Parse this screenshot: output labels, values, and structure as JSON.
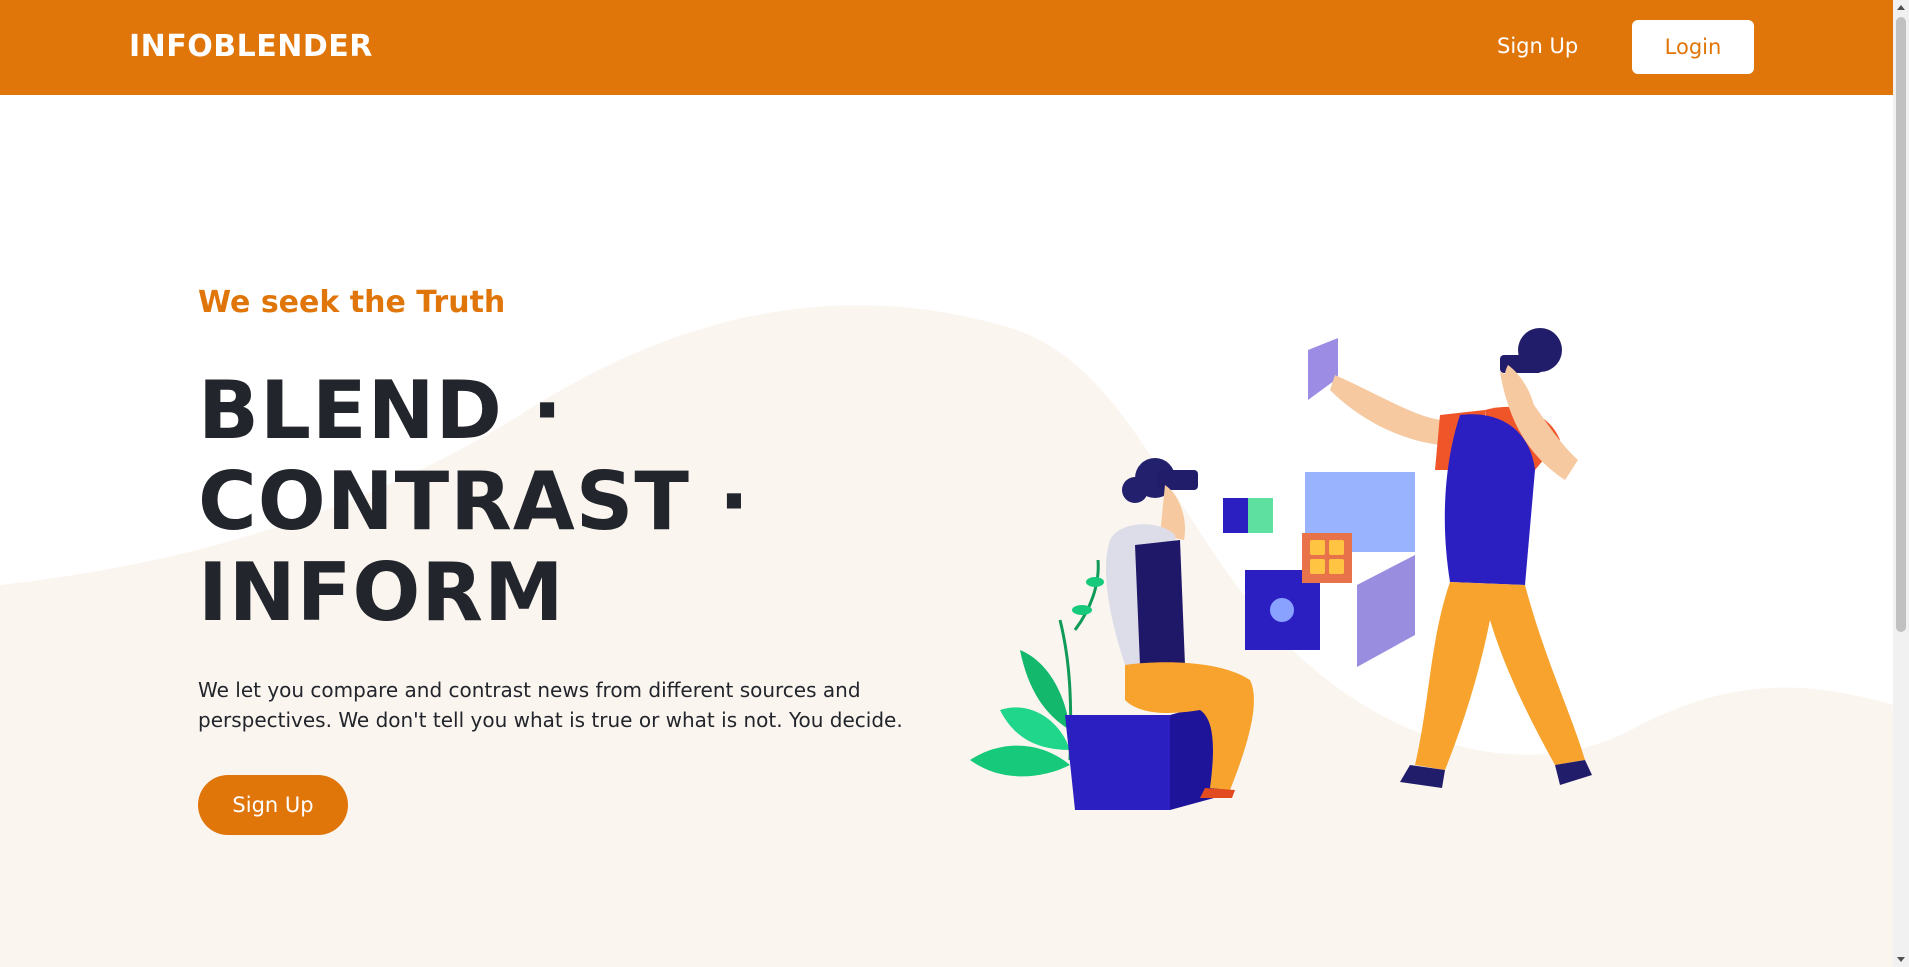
{
  "navbar": {
    "brand": "INFOBLENDER",
    "signup_label": "Sign Up",
    "login_label": "Login"
  },
  "hero": {
    "tagline": "We seek the Truth",
    "headline_lines": [
      "BLEND ·",
      "CONTRAST ·",
      "INFORM"
    ],
    "description": "We let you compare and contrast news from different sources and perspectives. We don't tell you what is true or what is not. You decide.",
    "cta_label": "Sign Up"
  },
  "colors": {
    "brand": "#e07509",
    "text_dark": "#22252b",
    "blob": "#fbf5f0"
  }
}
